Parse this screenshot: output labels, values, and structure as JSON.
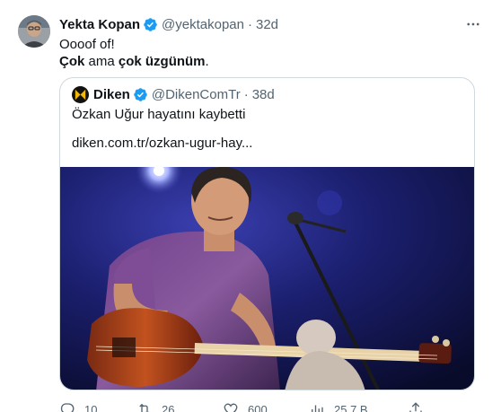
{
  "tweet": {
    "author_name": "Yekta Kopan",
    "author_handle": "@yektakopan",
    "separator": "·",
    "age": "32d",
    "line1": "Oooof of!",
    "line2_part1": "Çok",
    "line2_part2": " ama ",
    "line2_part3": "çok üzgünüm",
    "line2_part4": "."
  },
  "quote": {
    "author_name": "Diken",
    "author_handle": "@DikenComTr",
    "separator": "·",
    "age": "38d",
    "title": "Özkan Uğur hayatını kaybetti",
    "link": "diken.com.tr/ozkan-ugur-hay..."
  },
  "actions": {
    "replies": "10",
    "reposts": "26",
    "likes": "600",
    "views": "25,7 B"
  },
  "icons": {
    "more": "more-horizontal-icon",
    "verified": "verified-badge-icon",
    "reply": "reply-icon",
    "repost": "repost-icon",
    "like": "like-icon",
    "views": "views-icon",
    "share": "share-icon"
  },
  "colors": {
    "verified": "#1d9bf0",
    "muted": "#536471",
    "border": "#cfd9de",
    "diken_logo": "#f5b800"
  }
}
